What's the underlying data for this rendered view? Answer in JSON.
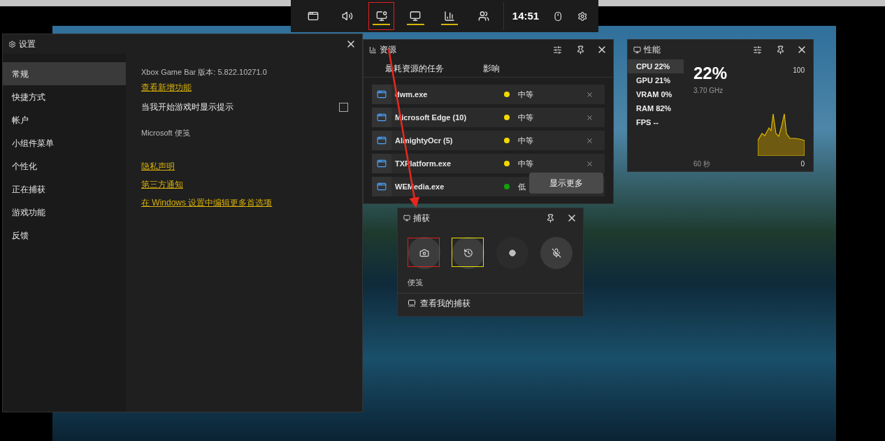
{
  "top_bar": {
    "items": [
      {
        "kind": "widgets",
        "active": false,
        "highlighted": false
      },
      {
        "kind": "audio",
        "active": false,
        "highlighted": false
      },
      {
        "kind": "capture",
        "active": true,
        "highlighted": true
      },
      {
        "kind": "performance",
        "active": true,
        "highlighted": false
      },
      {
        "kind": "resources",
        "active": true,
        "highlighted": false
      },
      {
        "kind": "social",
        "active": false,
        "highlighted": false
      }
    ],
    "time": "14:51"
  },
  "settings": {
    "title": "设置",
    "nav": [
      {
        "label": "常规",
        "selected": true
      },
      {
        "label": "快捷方式",
        "selected": false
      },
      {
        "label": "帐户",
        "selected": false
      },
      {
        "label": "小组件菜单",
        "selected": false
      },
      {
        "label": "个性化",
        "selected": false
      },
      {
        "label": "正在捕获",
        "selected": false
      },
      {
        "label": "游戏功能",
        "selected": false
      },
      {
        "label": "反馈",
        "selected": false
      }
    ],
    "version": "Xbox Game Bar 版本: 5.822.10271.0",
    "whats_new_link": "查看新增功能",
    "tips_checkbox": {
      "label": "当我开始游戏时显示提示",
      "checked": false
    },
    "notes_label": "Microsoft 便笺",
    "links": [
      "隐私声明",
      "第三方通知",
      "在 Windows 设置中编辑更多首选项"
    ]
  },
  "resources": {
    "title": "资源",
    "columns": [
      "最耗资源的任务",
      "影响"
    ],
    "rows": [
      {
        "name": "dwm.exe",
        "impact": "中等",
        "color": "#f2d800"
      },
      {
        "name": "Microsoft Edge (10)",
        "impact": "中等",
        "color": "#f2d800"
      },
      {
        "name": "AlmightyOcr (5)",
        "impact": "中等",
        "color": "#f2d800"
      },
      {
        "name": "TXPlatform.exe",
        "impact": "中等",
        "color": "#f2d800"
      },
      {
        "name": "WEMedia.exe",
        "impact": "低",
        "color": "#13a10e"
      }
    ],
    "show_more": "显示更多"
  },
  "performance": {
    "title": "性能",
    "metrics": [
      {
        "label": "CPU",
        "value": "22%",
        "selected": true
      },
      {
        "label": "GPU",
        "value": "21%",
        "selected": false
      },
      {
        "label": "VRAM",
        "value": "0%",
        "selected": false
      },
      {
        "label": "RAM",
        "value": "82%",
        "selected": false
      },
      {
        "label": "FPS",
        "value": "--",
        "selected": false
      }
    ],
    "big_value": "22%",
    "frequency": "3.70 GHz",
    "axis_max": "100",
    "axis_min": "0",
    "duration": "60 秒"
  },
  "capture": {
    "title": "捕获",
    "buttons": [
      {
        "kind": "screenshot",
        "color": "#e02020"
      },
      {
        "kind": "record_last",
        "color": "#e8e000"
      },
      {
        "kind": "record"
      },
      {
        "kind": "mic_off"
      }
    ],
    "notes_label": "便笺",
    "footer": "查看我的捕获"
  }
}
